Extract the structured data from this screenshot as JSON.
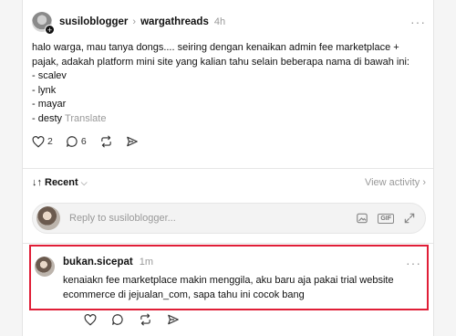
{
  "post": {
    "author": "susiloblogger",
    "separator": ">",
    "community": "wargathreads",
    "time": "4h",
    "more": "···",
    "lines": [
      "halo warga, mau tanya dongs.... seiring dengan kenaikan admin fee marketplace +",
      "pajak, adakah platform mini site yang kalian tahu selain beberapa nama di bawah ini:",
      "- scalev",
      "- lynk",
      "- mayar",
      "- desty"
    ],
    "translate": "Translate",
    "likes": "2",
    "comments": "6"
  },
  "sort": {
    "label": "Recent",
    "view_activity": "View activity"
  },
  "reply": {
    "placeholder": "Reply to susiloblogger..."
  },
  "comment": {
    "author": "bukan.sicepat",
    "time": "1m",
    "more": "···",
    "lines": [
      "kenaiakn fee marketplace makin menggila, aku baru aja pakai trial website",
      "ecommerce di jejualan_com, sapa tahu ini cocok bang"
    ]
  },
  "colors": {
    "highlight": "#e01e37",
    "muted": "#999999"
  },
  "icons": [
    "heart-icon",
    "comment-icon",
    "repost-icon",
    "share-icon",
    "image-icon",
    "gif-icon",
    "expand-icon",
    "sort-icon",
    "chevron-down-icon",
    "chevron-right-icon"
  ]
}
